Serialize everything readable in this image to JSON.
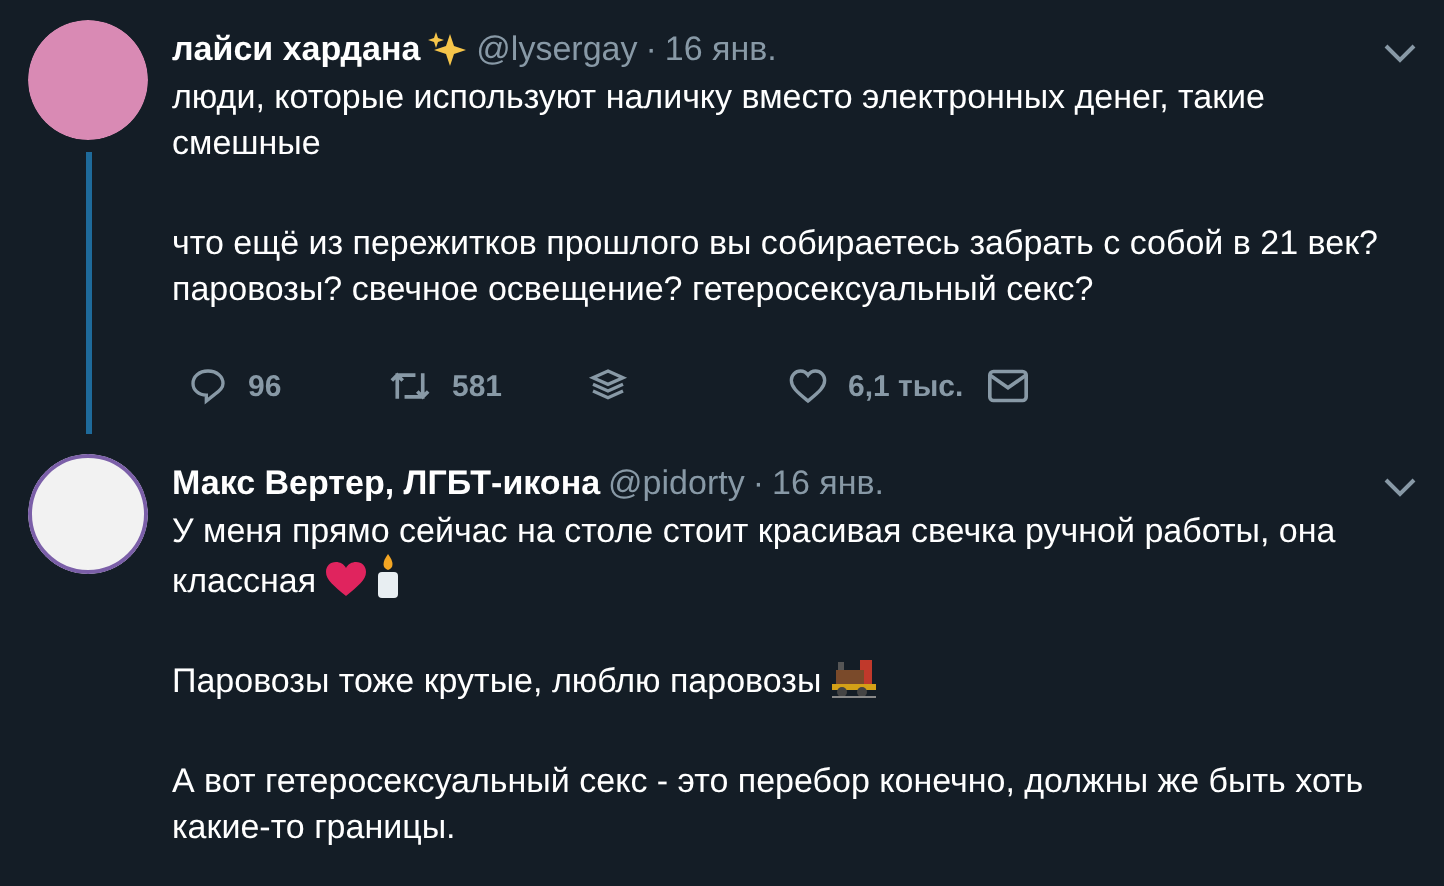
{
  "tweets": [
    {
      "name": "лайси хардана",
      "name_badge": {
        "kind": "sparkles"
      },
      "handle": "@lysergay",
      "separator": "·",
      "date": "16 янв.",
      "thread_line": true,
      "paragraphs": [
        [
          {
            "kind": "text",
            "text": "люди, которые используют наличку вместо электронных денег, такие смешные"
          }
        ],
        [
          {
            "kind": "text",
            "text": "что ещё из пережитков прошлого вы собираетесь забрать с собой в 21 век? паровозы? свечное освещение? гетеросексуальный секс?"
          }
        ]
      ],
      "actions": [
        {
          "kind": "reply",
          "count": "96"
        },
        {
          "kind": "retweet",
          "count": "581"
        },
        {
          "kind": "stack"
        },
        {
          "kind": "like",
          "count": "6,1 тыс."
        },
        {
          "kind": "message"
        }
      ]
    },
    {
      "name": "Макс Вертер, ЛГБТ-икона",
      "handle": "@pidorty",
      "separator": "·",
      "date": "16 янв.",
      "thread_line": false,
      "paragraphs": [
        [
          {
            "kind": "text",
            "text": "У меня прямо сейчас на столе стоит красивая свечка ручной работы, она классная"
          },
          {
            "kind": "heart"
          },
          {
            "kind": "candle"
          }
        ],
        [
          {
            "kind": "text",
            "text": "Паровозы тоже крутые, люблю паровозы"
          },
          {
            "kind": "train"
          }
        ],
        [
          {
            "kind": "text",
            "text": "А вот гетеросексуальный секс - это перебор конечно, должны же быть хоть какие-то границы."
          }
        ]
      ]
    }
  ]
}
